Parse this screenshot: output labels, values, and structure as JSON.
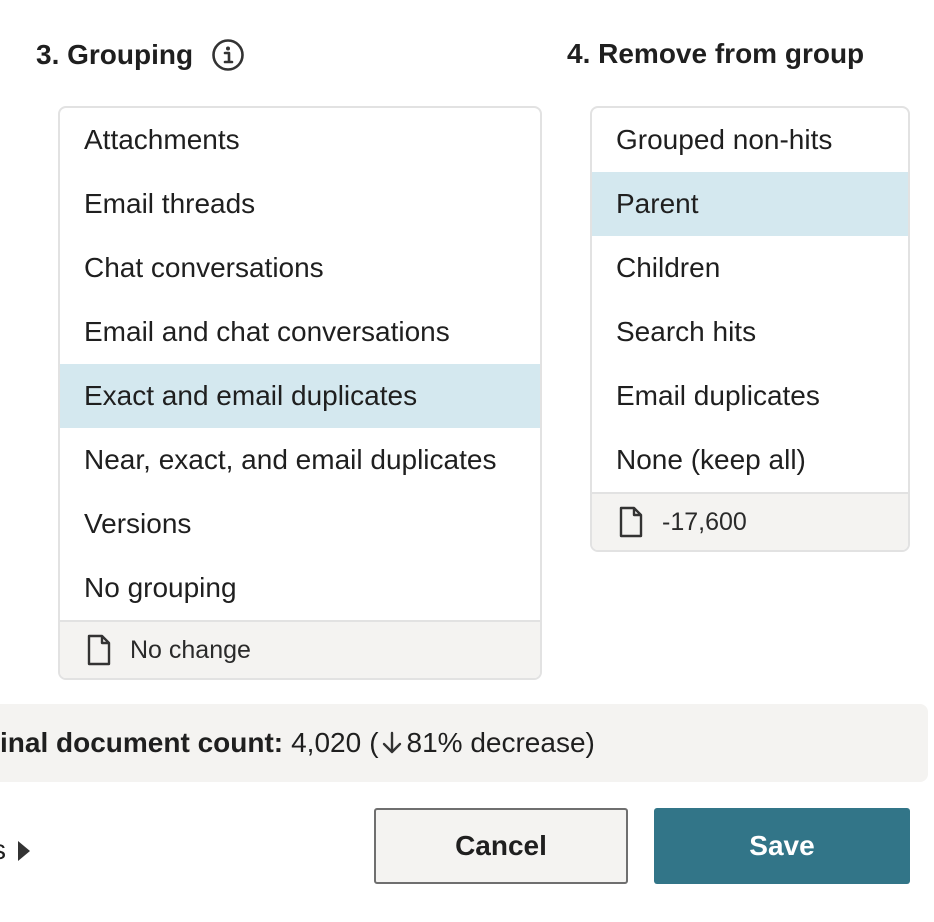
{
  "grouping": {
    "title": "3. Grouping",
    "items": [
      {
        "label": "Attachments",
        "selected": false
      },
      {
        "label": "Email threads",
        "selected": false
      },
      {
        "label": "Chat conversations",
        "selected": false
      },
      {
        "label": "Email and chat conversations",
        "selected": false
      },
      {
        "label": "Exact and email duplicates",
        "selected": true
      },
      {
        "label": "Near, exact, and email duplicates",
        "selected": false
      },
      {
        "label": "Versions",
        "selected": false
      },
      {
        "label": "No grouping",
        "selected": false
      }
    ],
    "footer": "No change"
  },
  "remove": {
    "title": "4. Remove from group",
    "items": [
      {
        "label": "Grouped non-hits",
        "selected": false
      },
      {
        "label": "Parent",
        "selected": true
      },
      {
        "label": "Children",
        "selected": false
      },
      {
        "label": "Search hits",
        "selected": false
      },
      {
        "label": "Email duplicates",
        "selected": false
      },
      {
        "label": "None (keep all)",
        "selected": false
      }
    ],
    "footer": "-17,600"
  },
  "summary": {
    "label": "inal document count:",
    "count": "4,020",
    "open_paren": "(",
    "change": "81% decrease)"
  },
  "actions": {
    "more_label": "s",
    "cancel": "Cancel",
    "save": "Save"
  },
  "colors": {
    "selected": "#d4e8ef",
    "primary": "#327588",
    "footer_bg": "#f4f3f1"
  }
}
